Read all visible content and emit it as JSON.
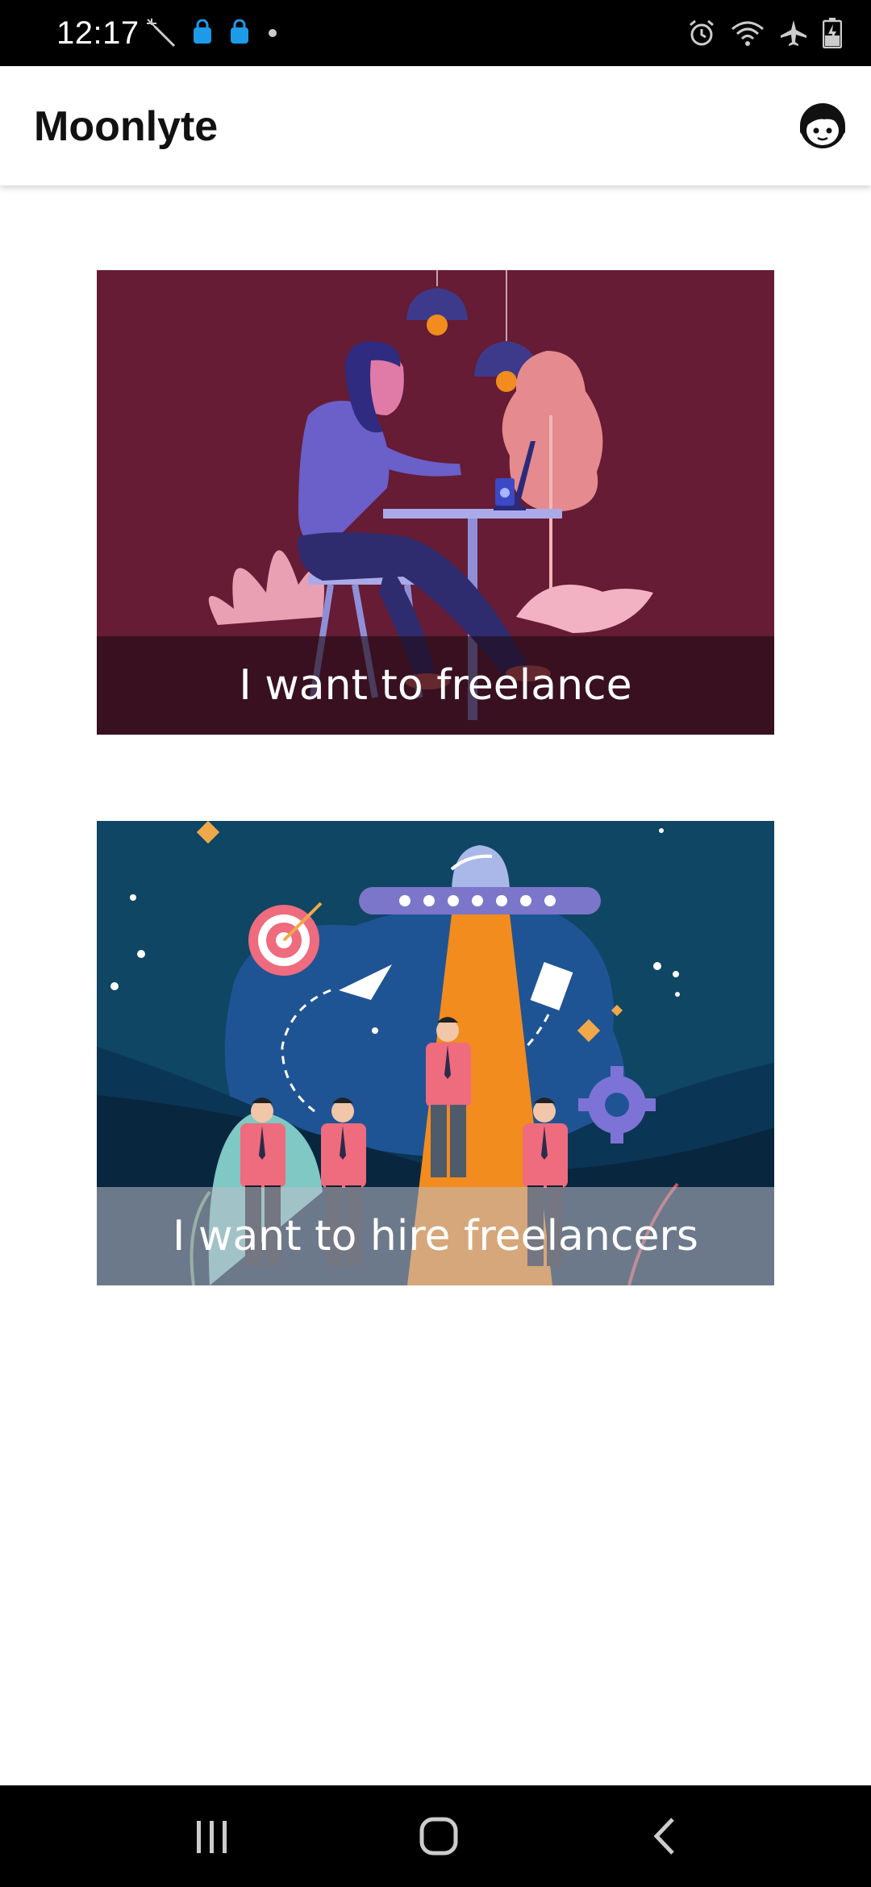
{
  "status_bar": {
    "time": "12:17",
    "left_icons": [
      "magic-wand-icon",
      "shopping-bag-icon",
      "shopping-bag-icon",
      "dot-icon"
    ],
    "right_icons": [
      "alarm-icon",
      "wifi-icon",
      "airplane-mode-icon",
      "battery-charging-icon"
    ]
  },
  "app_bar": {
    "title": "Moonlyte",
    "action_icon": "support-agent-icon"
  },
  "cards": [
    {
      "label": "I want to freelance",
      "background": "#651c34"
    },
    {
      "label": "I want to hire freelancers",
      "background": "#0e4664"
    }
  ],
  "nav_bar": {
    "buttons": [
      "recents-icon",
      "home-icon",
      "back-icon"
    ]
  },
  "colors": {
    "accent_orange": "#f28c1e",
    "accent_pink": "#ef6b7e",
    "accent_purple": "#6b5fc9"
  }
}
